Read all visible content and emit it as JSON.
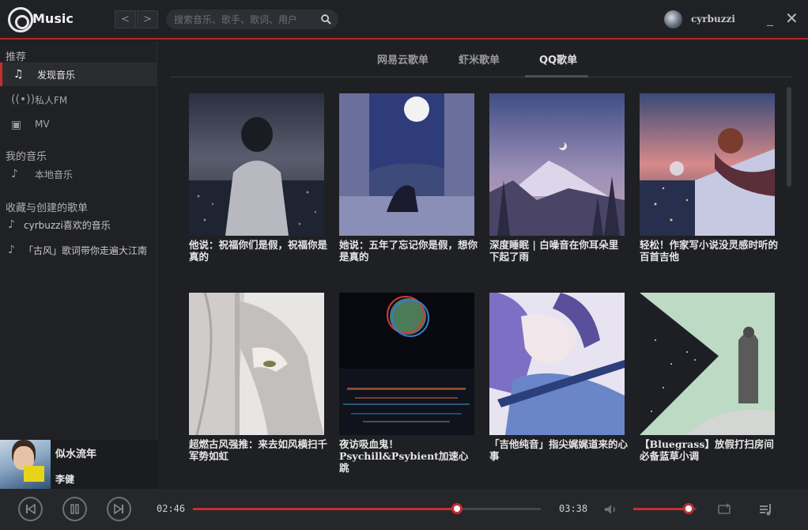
{
  "app": {
    "title": "Music"
  },
  "nav": {
    "back": "<",
    "forward": ">"
  },
  "search": {
    "placeholder": "搜索音乐、歌手、歌词、用户"
  },
  "user": {
    "name": "cyrbuzzi"
  },
  "window": {
    "minimize": "_",
    "close": "✕"
  },
  "sidebar": {
    "sections": [
      {
        "title": "推荐"
      },
      {
        "title": "我的音乐"
      },
      {
        "title": "收藏与创建的歌单"
      }
    ],
    "recommend": [
      {
        "label": "发现音乐",
        "icon": "music-note-icon",
        "active": true
      },
      {
        "label": "私人FM",
        "icon": "radio-icon",
        "active": false
      },
      {
        "label": "MV",
        "icon": "video-icon",
        "active": false
      }
    ],
    "my_music": [
      {
        "label": "本地音乐",
        "icon": "music-note-icon"
      }
    ],
    "playlists": [
      {
        "label": "cyrbuzzi喜欢的音乐",
        "icon": "music-note-icon"
      },
      {
        "label": "「古风」歌词带你走遍大江南",
        "icon": "music-note-icon"
      }
    ]
  },
  "now_playing": {
    "title": "似水流年",
    "artist": "李健"
  },
  "tabs": [
    {
      "label": "网易云歌单",
      "active": false
    },
    {
      "label": "虾米歌单",
      "active": false
    },
    {
      "label": "QQ歌单",
      "active": true
    }
  ],
  "playlists_grid": [
    {
      "caption": "他说：祝福你们是假，祝福你是真的"
    },
    {
      "caption": "她说：五年了忘记你是假，想你是真的"
    },
    {
      "caption": "深度睡眠 | 白噪音在你耳朵里下起了雨"
    },
    {
      "caption": "轻松！作家写小说没灵感时听的百首吉他"
    },
    {
      "caption": "超燃古风强推：来去如风横扫千军势如虹"
    },
    {
      "caption": "夜访吸血鬼！Psychill&Psybient加速心跳"
    },
    {
      "caption": "「吉他纯音」指尖娓娓道来的心事"
    },
    {
      "caption": "【Bluegrass】放假打扫房间必备蓝草小调"
    }
  ],
  "player": {
    "current_time": "02:46",
    "total_time": "03:38",
    "progress": 0.76,
    "volume": 0.88
  },
  "colors": {
    "accent": "#c62f2f",
    "background": "#1f2024"
  }
}
